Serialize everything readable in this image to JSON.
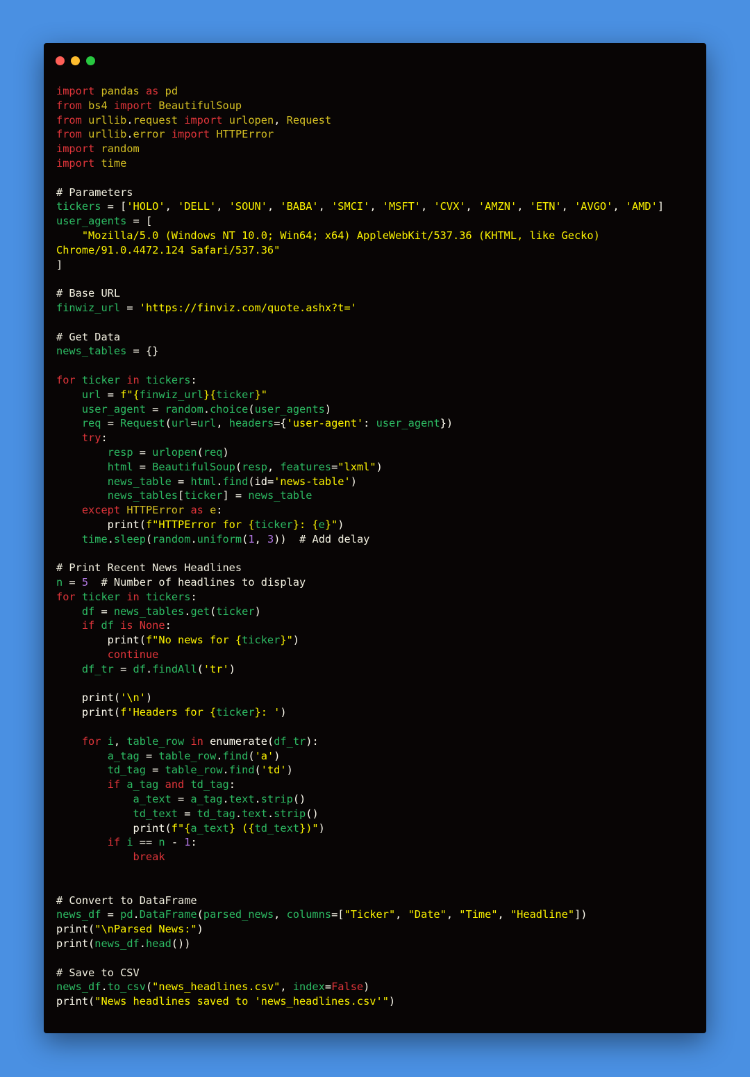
{
  "window": {
    "buttons": [
      {
        "name": "close-button",
        "color": "#ff5f57"
      },
      {
        "name": "minimize-button",
        "color": "#febc2e"
      },
      {
        "name": "maximize-button",
        "color": "#28c840"
      }
    ]
  },
  "colors": {
    "background": "#4a90e2",
    "editor_background": "#080505",
    "keyword": "#e0353a",
    "module": "#d4bf23",
    "comment": "#f2f0e0",
    "variable": "#2dbb63",
    "string": "#fbf200",
    "number": "#b277e4",
    "plain": "#fffdf0"
  },
  "code_lines": [
    [
      [
        "keyword",
        "import"
      ],
      [
        "plain",
        " "
      ],
      [
        "module",
        "pandas"
      ],
      [
        "plain",
        " "
      ],
      [
        "keyword",
        "as"
      ],
      [
        "plain",
        " "
      ],
      [
        "module",
        "pd"
      ]
    ],
    [
      [
        "keyword",
        "from"
      ],
      [
        "plain",
        " "
      ],
      [
        "module",
        "bs4"
      ],
      [
        "plain",
        " "
      ],
      [
        "keyword",
        "import"
      ],
      [
        "plain",
        " "
      ],
      [
        "module",
        "BeautifulSoup"
      ]
    ],
    [
      [
        "keyword",
        "from"
      ],
      [
        "plain",
        " "
      ],
      [
        "module",
        "urllib"
      ],
      [
        "plain",
        "."
      ],
      [
        "module",
        "request"
      ],
      [
        "plain",
        " "
      ],
      [
        "keyword",
        "import"
      ],
      [
        "plain",
        " "
      ],
      [
        "module",
        "urlopen"
      ],
      [
        "plain",
        ", "
      ],
      [
        "module",
        "Request"
      ]
    ],
    [
      [
        "keyword",
        "from"
      ],
      [
        "plain",
        " "
      ],
      [
        "module",
        "urllib"
      ],
      [
        "plain",
        "."
      ],
      [
        "module",
        "error"
      ],
      [
        "plain",
        " "
      ],
      [
        "keyword",
        "import"
      ],
      [
        "plain",
        " "
      ],
      [
        "module",
        "HTTPError"
      ]
    ],
    [
      [
        "keyword",
        "import"
      ],
      [
        "plain",
        " "
      ],
      [
        "module",
        "random"
      ]
    ],
    [
      [
        "keyword",
        "import"
      ],
      [
        "plain",
        " "
      ],
      [
        "module",
        "time"
      ]
    ],
    [],
    [
      [
        "comment",
        "# Parameters"
      ]
    ],
    [
      [
        "variable",
        "tickers"
      ],
      [
        "plain",
        " = ["
      ],
      [
        "string",
        "'HOLO'"
      ],
      [
        "plain",
        ", "
      ],
      [
        "string",
        "'DELL'"
      ],
      [
        "plain",
        ", "
      ],
      [
        "string",
        "'SOUN'"
      ],
      [
        "plain",
        ", "
      ],
      [
        "string",
        "'BABA'"
      ],
      [
        "plain",
        ", "
      ],
      [
        "string",
        "'SMCI'"
      ],
      [
        "plain",
        ", "
      ],
      [
        "string",
        "'MSFT'"
      ],
      [
        "plain",
        ", "
      ],
      [
        "string",
        "'CVX'"
      ],
      [
        "plain",
        ", "
      ],
      [
        "string",
        "'AMZN'"
      ],
      [
        "plain",
        ", "
      ],
      [
        "string",
        "'ETN'"
      ],
      [
        "plain",
        ", "
      ],
      [
        "string",
        "'AVGO'"
      ],
      [
        "plain",
        ", "
      ],
      [
        "string",
        "'AMD'"
      ],
      [
        "plain",
        "]"
      ]
    ],
    [
      [
        "variable",
        "user_agents"
      ],
      [
        "plain",
        " = ["
      ]
    ],
    [
      [
        "plain",
        "    "
      ],
      [
        "string",
        "\"Mozilla/5.0 (Windows NT 10.0; Win64; x64) AppleWebKit/537.36 (KHTML, like Gecko)"
      ]
    ],
    [
      [
        "string",
        "Chrome/91.0.4472.124 Safari/537.36\""
      ]
    ],
    [
      [
        "plain",
        "]"
      ]
    ],
    [],
    [
      [
        "comment",
        "# Base URL"
      ]
    ],
    [
      [
        "variable",
        "finwiz_url"
      ],
      [
        "plain",
        " = "
      ],
      [
        "string",
        "'https://finviz.com/quote.ashx?t='"
      ]
    ],
    [],
    [
      [
        "comment",
        "# Get Data"
      ]
    ],
    [
      [
        "variable",
        "news_tables"
      ],
      [
        "plain",
        " = {}"
      ]
    ],
    [],
    [
      [
        "keyword",
        "for"
      ],
      [
        "plain",
        " "
      ],
      [
        "variable",
        "ticker"
      ],
      [
        "plain",
        " "
      ],
      [
        "keyword",
        "in"
      ],
      [
        "plain",
        " "
      ],
      [
        "variable",
        "tickers"
      ],
      [
        "plain",
        ":"
      ]
    ],
    [
      [
        "plain",
        "    "
      ],
      [
        "variable",
        "url"
      ],
      [
        "plain",
        " = "
      ],
      [
        "string",
        "f\"{"
      ],
      [
        "variable",
        "finwiz_url"
      ],
      [
        "string",
        "}{"
      ],
      [
        "variable",
        "ticker"
      ],
      [
        "string",
        "}\""
      ]
    ],
    [
      [
        "plain",
        "    "
      ],
      [
        "variable",
        "user_agent"
      ],
      [
        "plain",
        " = "
      ],
      [
        "variable",
        "random"
      ],
      [
        "plain",
        "."
      ],
      [
        "variable",
        "choice"
      ],
      [
        "plain",
        "("
      ],
      [
        "variable",
        "user_agents"
      ],
      [
        "plain",
        ")"
      ]
    ],
    [
      [
        "plain",
        "    "
      ],
      [
        "variable",
        "req"
      ],
      [
        "plain",
        " = "
      ],
      [
        "variable",
        "Request"
      ],
      [
        "plain",
        "("
      ],
      [
        "variable",
        "url"
      ],
      [
        "plain",
        "="
      ],
      [
        "variable",
        "url"
      ],
      [
        "plain",
        ", "
      ],
      [
        "variable",
        "headers"
      ],
      [
        "plain",
        "={"
      ],
      [
        "string",
        "'user-agent'"
      ],
      [
        "plain",
        ": "
      ],
      [
        "variable",
        "user_agent"
      ],
      [
        "plain",
        "})"
      ]
    ],
    [
      [
        "plain",
        "    "
      ],
      [
        "keyword",
        "try"
      ],
      [
        "plain",
        ":"
      ]
    ],
    [
      [
        "plain",
        "        "
      ],
      [
        "variable",
        "resp"
      ],
      [
        "plain",
        " = "
      ],
      [
        "variable",
        "urlopen"
      ],
      [
        "plain",
        "("
      ],
      [
        "variable",
        "req"
      ],
      [
        "plain",
        ")"
      ]
    ],
    [
      [
        "plain",
        "        "
      ],
      [
        "variable",
        "html"
      ],
      [
        "plain",
        " = "
      ],
      [
        "variable",
        "BeautifulSoup"
      ],
      [
        "plain",
        "("
      ],
      [
        "variable",
        "resp"
      ],
      [
        "plain",
        ", "
      ],
      [
        "variable",
        "features"
      ],
      [
        "plain",
        "="
      ],
      [
        "string",
        "\"lxml\""
      ],
      [
        "plain",
        ")"
      ]
    ],
    [
      [
        "plain",
        "        "
      ],
      [
        "variable",
        "news_table"
      ],
      [
        "plain",
        " = "
      ],
      [
        "variable",
        "html"
      ],
      [
        "plain",
        "."
      ],
      [
        "variable",
        "find"
      ],
      [
        "plain",
        "(id="
      ],
      [
        "string",
        "'news-table'"
      ],
      [
        "plain",
        ")"
      ]
    ],
    [
      [
        "plain",
        "        "
      ],
      [
        "variable",
        "news_tables"
      ],
      [
        "plain",
        "["
      ],
      [
        "variable",
        "ticker"
      ],
      [
        "plain",
        "] = "
      ],
      [
        "variable",
        "news_table"
      ]
    ],
    [
      [
        "plain",
        "    "
      ],
      [
        "keyword",
        "except"
      ],
      [
        "plain",
        " "
      ],
      [
        "module",
        "HTTPError"
      ],
      [
        "plain",
        " "
      ],
      [
        "keyword",
        "as"
      ],
      [
        "plain",
        " "
      ],
      [
        "module",
        "e"
      ],
      [
        "plain",
        ":"
      ]
    ],
    [
      [
        "plain",
        "        print("
      ],
      [
        "string",
        "f\"HTTPError for {"
      ],
      [
        "variable",
        "ticker"
      ],
      [
        "string",
        "}: {"
      ],
      [
        "variable",
        "e"
      ],
      [
        "string",
        "}\""
      ],
      [
        "plain",
        ")"
      ]
    ],
    [
      [
        "plain",
        "    "
      ],
      [
        "variable",
        "time"
      ],
      [
        "plain",
        "."
      ],
      [
        "variable",
        "sleep"
      ],
      [
        "plain",
        "("
      ],
      [
        "variable",
        "random"
      ],
      [
        "plain",
        "."
      ],
      [
        "variable",
        "uniform"
      ],
      [
        "plain",
        "("
      ],
      [
        "number",
        "1"
      ],
      [
        "plain",
        ", "
      ],
      [
        "number",
        "3"
      ],
      [
        "plain",
        "))  "
      ],
      [
        "comment",
        "# Add delay"
      ]
    ],
    [],
    [
      [
        "comment",
        "# Print Recent News Headlines"
      ]
    ],
    [
      [
        "variable",
        "n"
      ],
      [
        "plain",
        " = "
      ],
      [
        "number",
        "5"
      ],
      [
        "plain",
        "  "
      ],
      [
        "comment",
        "# Number of headlines to display"
      ]
    ],
    [
      [
        "keyword",
        "for"
      ],
      [
        "plain",
        " "
      ],
      [
        "variable",
        "ticker"
      ],
      [
        "plain",
        " "
      ],
      [
        "keyword",
        "in"
      ],
      [
        "plain",
        " "
      ],
      [
        "variable",
        "tickers"
      ],
      [
        "plain",
        ":"
      ]
    ],
    [
      [
        "plain",
        "    "
      ],
      [
        "variable",
        "df"
      ],
      [
        "plain",
        " = "
      ],
      [
        "variable",
        "news_tables"
      ],
      [
        "plain",
        "."
      ],
      [
        "variable",
        "get"
      ],
      [
        "plain",
        "("
      ],
      [
        "variable",
        "ticker"
      ],
      [
        "plain",
        ")"
      ]
    ],
    [
      [
        "plain",
        "    "
      ],
      [
        "keyword",
        "if"
      ],
      [
        "plain",
        " "
      ],
      [
        "variable",
        "df"
      ],
      [
        "plain",
        " "
      ],
      [
        "keyword",
        "is"
      ],
      [
        "plain",
        " "
      ],
      [
        "keyword",
        "None"
      ],
      [
        "plain",
        ":"
      ]
    ],
    [
      [
        "plain",
        "        print("
      ],
      [
        "string",
        "f\"No news for {"
      ],
      [
        "variable",
        "ticker"
      ],
      [
        "string",
        "}\""
      ],
      [
        "plain",
        ")"
      ]
    ],
    [
      [
        "plain",
        "        "
      ],
      [
        "keyword",
        "continue"
      ]
    ],
    [
      [
        "plain",
        "    "
      ],
      [
        "variable",
        "df_tr"
      ],
      [
        "plain",
        " = "
      ],
      [
        "variable",
        "df"
      ],
      [
        "plain",
        "."
      ],
      [
        "variable",
        "findAll"
      ],
      [
        "plain",
        "("
      ],
      [
        "string",
        "'tr'"
      ],
      [
        "plain",
        ")"
      ]
    ],
    [],
    [
      [
        "plain",
        "    print("
      ],
      [
        "string",
        "'\\n'"
      ],
      [
        "plain",
        ")"
      ]
    ],
    [
      [
        "plain",
        "    print("
      ],
      [
        "string",
        "f'Headers for {"
      ],
      [
        "variable",
        "ticker"
      ],
      [
        "string",
        "}: '"
      ],
      [
        "plain",
        ")"
      ]
    ],
    [],
    [
      [
        "plain",
        "    "
      ],
      [
        "keyword",
        "for"
      ],
      [
        "plain",
        " "
      ],
      [
        "variable",
        "i"
      ],
      [
        "plain",
        ", "
      ],
      [
        "variable",
        "table_row"
      ],
      [
        "plain",
        " "
      ],
      [
        "keyword",
        "in"
      ],
      [
        "plain",
        " enumerate("
      ],
      [
        "variable",
        "df_tr"
      ],
      [
        "plain",
        "):"
      ]
    ],
    [
      [
        "plain",
        "        "
      ],
      [
        "variable",
        "a_tag"
      ],
      [
        "plain",
        " = "
      ],
      [
        "variable",
        "table_row"
      ],
      [
        "plain",
        "."
      ],
      [
        "variable",
        "find"
      ],
      [
        "plain",
        "("
      ],
      [
        "string",
        "'a'"
      ],
      [
        "plain",
        ")"
      ]
    ],
    [
      [
        "plain",
        "        "
      ],
      [
        "variable",
        "td_tag"
      ],
      [
        "plain",
        " = "
      ],
      [
        "variable",
        "table_row"
      ],
      [
        "plain",
        "."
      ],
      [
        "variable",
        "find"
      ],
      [
        "plain",
        "("
      ],
      [
        "string",
        "'td'"
      ],
      [
        "plain",
        ")"
      ]
    ],
    [
      [
        "plain",
        "        "
      ],
      [
        "keyword",
        "if"
      ],
      [
        "plain",
        " "
      ],
      [
        "variable",
        "a_tag"
      ],
      [
        "plain",
        " "
      ],
      [
        "keyword",
        "and"
      ],
      [
        "plain",
        " "
      ],
      [
        "variable",
        "td_tag"
      ],
      [
        "plain",
        ":"
      ]
    ],
    [
      [
        "plain",
        "            "
      ],
      [
        "variable",
        "a_text"
      ],
      [
        "plain",
        " = "
      ],
      [
        "variable",
        "a_tag"
      ],
      [
        "plain",
        "."
      ],
      [
        "variable",
        "text"
      ],
      [
        "plain",
        "."
      ],
      [
        "variable",
        "strip"
      ],
      [
        "plain",
        "()"
      ]
    ],
    [
      [
        "plain",
        "            "
      ],
      [
        "variable",
        "td_text"
      ],
      [
        "plain",
        " = "
      ],
      [
        "variable",
        "td_tag"
      ],
      [
        "plain",
        "."
      ],
      [
        "variable",
        "text"
      ],
      [
        "plain",
        "."
      ],
      [
        "variable",
        "strip"
      ],
      [
        "plain",
        "()"
      ]
    ],
    [
      [
        "plain",
        "            print("
      ],
      [
        "string",
        "f\"{"
      ],
      [
        "variable",
        "a_text"
      ],
      [
        "string",
        "} ({"
      ],
      [
        "variable",
        "td_text"
      ],
      [
        "string",
        "})\""
      ],
      [
        "plain",
        ")"
      ]
    ],
    [
      [
        "plain",
        "        "
      ],
      [
        "keyword",
        "if"
      ],
      [
        "plain",
        " "
      ],
      [
        "variable",
        "i"
      ],
      [
        "plain",
        " == "
      ],
      [
        "variable",
        "n"
      ],
      [
        "plain",
        " - "
      ],
      [
        "number",
        "1"
      ],
      [
        "plain",
        ":"
      ]
    ],
    [
      [
        "plain",
        "            "
      ],
      [
        "keyword",
        "break"
      ]
    ],
    [],
    [],
    [
      [
        "comment",
        "# Convert to DataFrame"
      ]
    ],
    [
      [
        "variable",
        "news_df"
      ],
      [
        "plain",
        " = "
      ],
      [
        "variable",
        "pd"
      ],
      [
        "plain",
        "."
      ],
      [
        "variable",
        "DataFrame"
      ],
      [
        "plain",
        "("
      ],
      [
        "variable",
        "parsed_news"
      ],
      [
        "plain",
        ", "
      ],
      [
        "variable",
        "columns"
      ],
      [
        "plain",
        "=["
      ],
      [
        "string",
        "\"Ticker\""
      ],
      [
        "plain",
        ", "
      ],
      [
        "string",
        "\"Date\""
      ],
      [
        "plain",
        ", "
      ],
      [
        "string",
        "\"Time\""
      ],
      [
        "plain",
        ", "
      ],
      [
        "string",
        "\"Headline\""
      ],
      [
        "plain",
        "])"
      ]
    ],
    [
      [
        "plain",
        "print("
      ],
      [
        "string",
        "\"\\nParsed News:\""
      ],
      [
        "plain",
        ")"
      ]
    ],
    [
      [
        "plain",
        "print("
      ],
      [
        "variable",
        "news_df"
      ],
      [
        "plain",
        "."
      ],
      [
        "variable",
        "head"
      ],
      [
        "plain",
        "())"
      ]
    ],
    [],
    [
      [
        "comment",
        "# Save to CSV"
      ]
    ],
    [
      [
        "variable",
        "news_df"
      ],
      [
        "plain",
        "."
      ],
      [
        "variable",
        "to_csv"
      ],
      [
        "plain",
        "("
      ],
      [
        "string",
        "\"news_headlines.csv\""
      ],
      [
        "plain",
        ", "
      ],
      [
        "variable",
        "index"
      ],
      [
        "plain",
        "="
      ],
      [
        "keyword",
        "False"
      ],
      [
        "plain",
        ")"
      ]
    ],
    [
      [
        "plain",
        "print("
      ],
      [
        "string",
        "\"News headlines saved to 'news_headlines.csv'\""
      ],
      [
        "plain",
        ")"
      ]
    ]
  ]
}
